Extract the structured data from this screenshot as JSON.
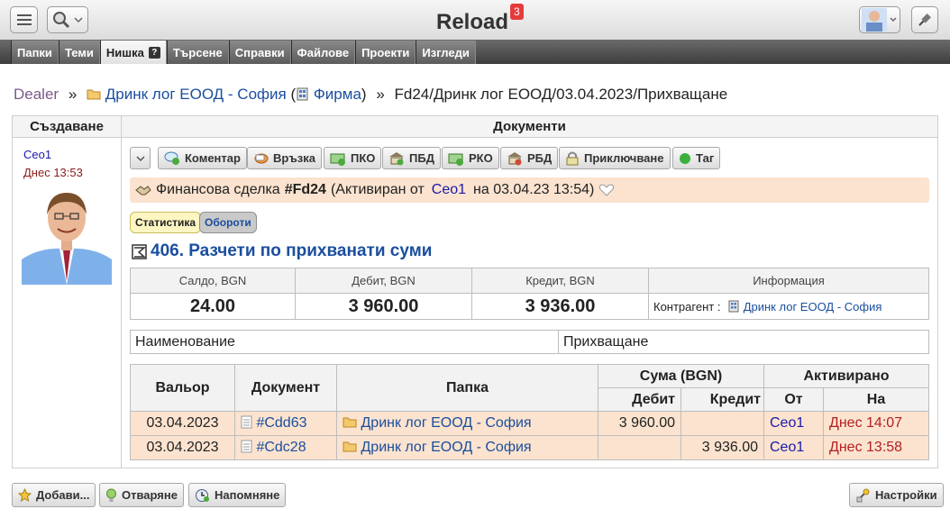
{
  "app": {
    "title": "Reload",
    "notifications": "3"
  },
  "menu": [
    {
      "label": "Папки"
    },
    {
      "label": "Теми"
    },
    {
      "label": "Нишка",
      "active": true
    },
    {
      "label": "Търсене"
    },
    {
      "label": "Справки"
    },
    {
      "label": "Файлове"
    },
    {
      "label": "Проекти"
    },
    {
      "label": "Изгледи"
    }
  ],
  "menu_help": "?",
  "breadcrumb": {
    "root": "Dealer",
    "sep": "»",
    "folder": "Дринк лог ЕООД - София",
    "open_paren": "(",
    "type": "Фирма",
    "close_paren": ")",
    "path": "Fd24/Дринк лог ЕООД/03.04.2023/Прихващане"
  },
  "columns": {
    "left": "Създаване",
    "right": "Документи"
  },
  "creator": {
    "name": "Ceo1",
    "time": "Днес 13:53"
  },
  "actions": [
    "Коментар",
    "Връзка",
    "ПКО",
    "ПБД",
    "РКО",
    "РБД",
    "Приключване",
    "Таг"
  ],
  "deal": {
    "prefix": "Финансова сделка",
    "number": "#Fd24",
    "status": "(Активиран от",
    "user": "Ceo1",
    "date": "на 03.04.23 13:54)"
  },
  "tags": {
    "stats": "Статистика",
    "turnover": "Обороти"
  },
  "account": {
    "title": "406. Разчети по прихванати суми"
  },
  "balance": {
    "headers": [
      "Салдо, BGN",
      "Дебит, BGN",
      "Кредит, BGN",
      "Информация"
    ],
    "values": [
      "24.00",
      "3 960.00",
      "3 936.00"
    ],
    "info_label": "Контрагент :",
    "info_value": "Дринк лог ЕООД - София"
  },
  "naming": {
    "label": "Наименование",
    "value": "Прихващане"
  },
  "movements": {
    "headers": {
      "valor": "Вальор",
      "document": "Документ",
      "folder": "Папка",
      "sum": "Сума (BGN)",
      "activated": "Активирано",
      "debit": "Дебит",
      "credit": "Кредит",
      "from": "От",
      "on": "На"
    },
    "rows": [
      {
        "date": "03.04.2023",
        "doc": "#Cdd63",
        "folder": "Дринк лог ЕООД - София",
        "debit": "3 960.00",
        "credit": "",
        "from": "Ceo1",
        "on": "Днес 14:07"
      },
      {
        "date": "03.04.2023",
        "doc": "#Cdc28",
        "folder": "Дринк лог ЕООД - София",
        "debit": "",
        "credit": "3 936.00",
        "from": "Ceo1",
        "on": "Днес 13:58"
      }
    ]
  },
  "bottom": {
    "add": "Добави...",
    "reject": "Отваряне",
    "remind": "Напомняне",
    "settings": "Настройки"
  },
  "colors": {
    "accent": "#1a4e9e",
    "highlight": "#fbe3cf",
    "badge": "#e53b3b"
  }
}
